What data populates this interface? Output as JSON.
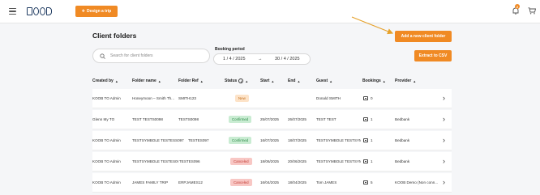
{
  "header": {
    "logo_text": "KOOB",
    "design_trip_label": "Design a trip",
    "notification_count": "2"
  },
  "page": {
    "title": "Client folders",
    "add_button": "Add a new client folder",
    "export_button": "Extract to CSV"
  },
  "filters": {
    "search_placeholder": "Search for client folders",
    "booking_period_label": "Booking period",
    "date_from": "1 / 4 / 2025",
    "date_to": "30 / 4 / 2025",
    "date_arrow": "→"
  },
  "columns": {
    "created_by": "Created by",
    "folder_name": "Folder name",
    "folder_ref": "Folder Ref",
    "status": "Status",
    "start": "Start",
    "end": "End",
    "guest": "Guest",
    "bookings": "Bookings",
    "provider": "Provider"
  },
  "rows": [
    {
      "created_by": "KOOB TO Admin",
      "folder_name": "Honeymoon – Smith Th...",
      "folder_ref": "SMITH123",
      "status": "New",
      "status_type": "new",
      "start": "",
      "end": "",
      "guest": "Donald SMITH",
      "bookings": "0",
      "provider": ""
    },
    {
      "created_by": "Glenn My TO",
      "folder_name": "TEST TESTS0098",
      "folder_ref": "TESTS0098",
      "status": "Confirmed",
      "status_type": "confirmed",
      "start": "25/07/2025",
      "end": "26/07/2025",
      "guest": "TEST TEST",
      "bookings": "1",
      "provider": "Bedbank"
    },
    {
      "created_by": "KOOB TO Admin",
      "folder_name": "TESTSYMBOLE TESTESS097",
      "folder_ref": "TESTES097",
      "status": "Confirmed",
      "status_type": "confirmed",
      "start": "16/07/2025",
      "end": "18/07/2025",
      "guest": "TESTSYMBOLE TESTSYM...",
      "bookings": "1",
      "provider": "Bedbank"
    },
    {
      "created_by": "KOOB TO Admin",
      "folder_name": "TESTSYMBOLE TESTES096",
      "folder_ref": "TESTES096",
      "status": "Canceled",
      "status_type": "cancelled",
      "start": "18/06/2025",
      "end": "20/06/2025",
      "guest": "TESTSYMBOLE TESTSYM...",
      "bookings": "1",
      "provider": "Bedbank"
    },
    {
      "created_by": "KOOB TO Admin",
      "folder_name": "JAMES FAMILY TRIP",
      "folder_ref": "ERPJAMES12",
      "status": "Canceled",
      "status_type": "cancelled",
      "start": "16/04/2025",
      "end": "18/04/2025",
      "guest": "Tom JAMES",
      "bookings": "5",
      "provider": "KOOB Demo (Non conn..."
    }
  ],
  "colors": {
    "accent": "#f08a24",
    "logo": "#1f3b61",
    "status_new": "#fde3c8",
    "status_confirmed": "#c9ecd2",
    "status_cancelled": "#f8c7c4"
  },
  "icons": {
    "menu": "hamburger-icon",
    "design": "plane-icon",
    "notifications": "bell-icon",
    "cart": "cart-icon",
    "search": "search-icon",
    "bookings": "suitcase-icon",
    "row_action": "chevron-right-icon"
  }
}
